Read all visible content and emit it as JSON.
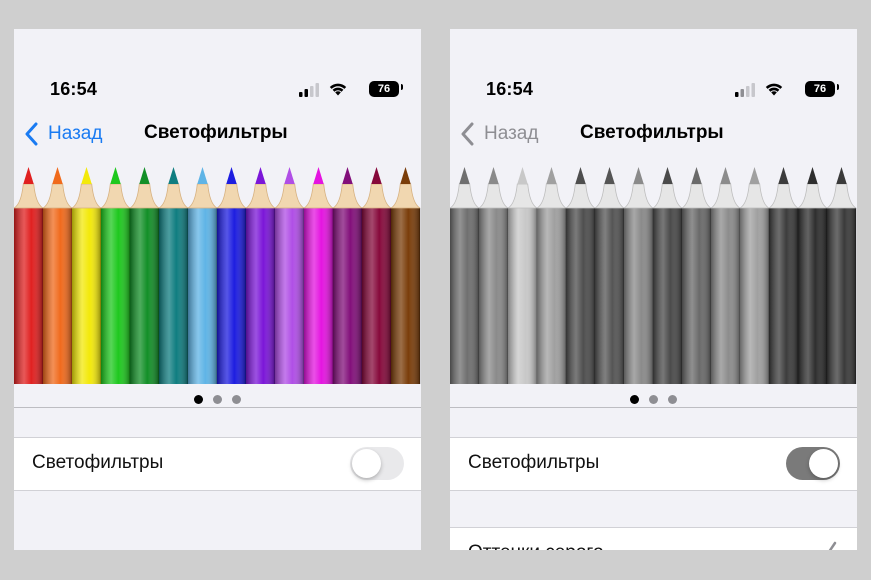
{
  "screens": [
    {
      "id": "left",
      "status": {
        "time": "16:54",
        "battery": "76"
      },
      "nav": {
        "back_label": "Назад",
        "title": "Светофильтры",
        "accent": "#1a7bf2"
      },
      "carousel": {
        "pages": 3,
        "active_page": 1,
        "pencil_colors": [
          "#e02020",
          "#f06a1c",
          "#f3e90a",
          "#1ec81e",
          "#128f27",
          "#0f7d80",
          "#5fb4e6",
          "#1d1de0",
          "#7b16d8",
          "#b04ee6",
          "#e414e0",
          "#820f7a",
          "#86093b",
          "#7a3d0a"
        ]
      },
      "toggle_row": {
        "label": "Светофильтры",
        "on": false
      },
      "filter_row": null
    },
    {
      "id": "right",
      "status": {
        "time": "16:54",
        "battery": "76"
      },
      "nav": {
        "back_label": "Назад",
        "title": "Светофильтры",
        "accent": "#8e8e93"
      },
      "carousel": {
        "pages": 3,
        "active_page": 1,
        "pencil_colors": [
          "#6f6f6f",
          "#8a8a8a",
          "#c8c8c8",
          "#a0a0a0",
          "#4e4e4e",
          "#555555",
          "#8a8a8a",
          "#4a4a4a",
          "#6a6a6a",
          "#8c8c8c",
          "#a0a0a0",
          "#3c3c3c",
          "#2e2e2e",
          "#3a3a3a"
        ]
      },
      "toggle_row": {
        "label": "Светофильтры",
        "on": true
      },
      "filter_row": {
        "label": "Оттенки серого",
        "checked": true
      }
    }
  ]
}
